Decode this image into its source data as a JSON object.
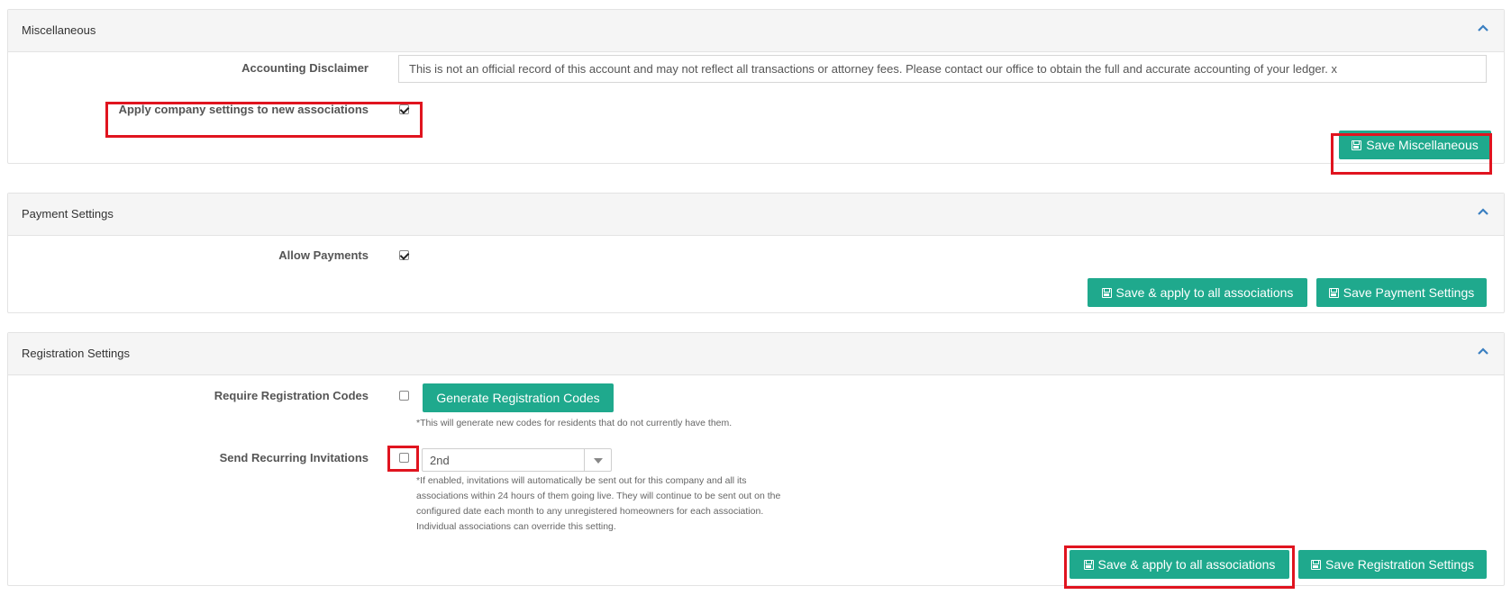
{
  "miscellaneous": {
    "title": "Miscellaneous",
    "accounting_disclaimer_label": "Accounting Disclaimer",
    "accounting_disclaimer_value": "This is not an official record of this account and may not reflect all transactions or attorney fees. Please contact our office to obtain the full and accurate accounting of your ledger. x",
    "apply_company_label": "Apply company settings to new associations",
    "apply_company_checked": true,
    "save_label": "Save Miscellaneous"
  },
  "payment": {
    "title": "Payment Settings",
    "allow_payments_label": "Allow Payments",
    "allow_payments_checked": true,
    "save_apply_label": "Save & apply to all associations",
    "save_label": "Save Payment Settings"
  },
  "registration": {
    "title": "Registration Settings",
    "require_codes_label": "Require Registration Codes",
    "require_codes_checked": false,
    "generate_label": "Generate Registration Codes",
    "generate_help": "*This will generate new codes for residents that do not currently have them.",
    "recurring_label": "Send Recurring Invitations",
    "recurring_checked": false,
    "recurring_day": "2nd",
    "recurring_help": [
      "*If enabled, invitations will automatically be sent out for this company and all its",
      "associations within 24 hours of them going live. They will continue to be sent out on the",
      "configured date each month to any unregistered homeowners for each association.",
      "Individual associations can override this setting."
    ],
    "save_apply_label": "Save & apply to all associations",
    "save_label": "Save Registration Settings"
  },
  "colors": {
    "accent": "#1fa98d",
    "highlight": "#e0141f",
    "chevron": "#3a7fc1"
  }
}
